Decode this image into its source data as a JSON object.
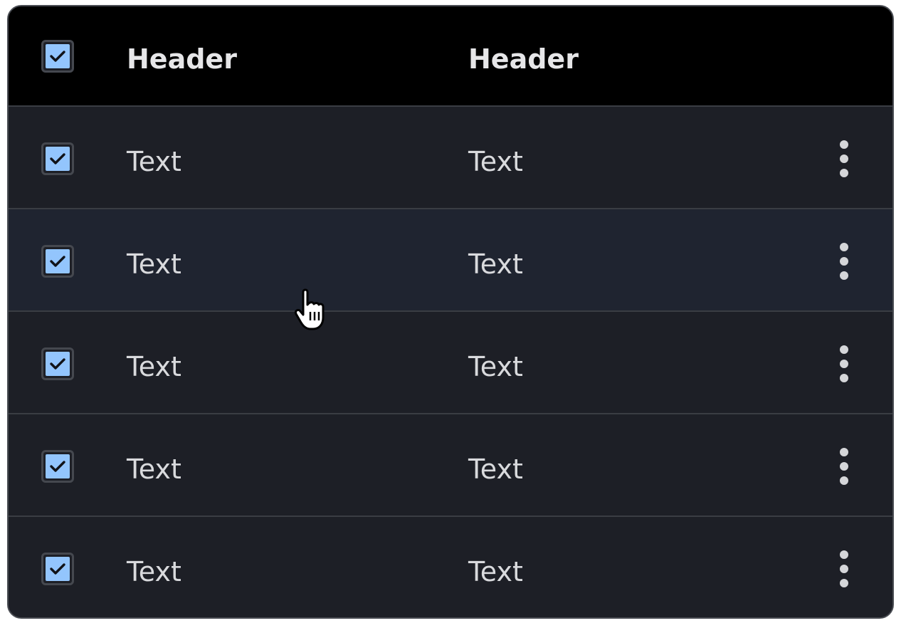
{
  "table": {
    "columns": [
      "Header",
      "Header"
    ],
    "header_checked": true,
    "rows": [
      {
        "cells": [
          "Text",
          "Text"
        ],
        "checked": true
      },
      {
        "cells": [
          "Text",
          "Text"
        ],
        "checked": true
      },
      {
        "cells": [
          "Text",
          "Text"
        ],
        "checked": true
      },
      {
        "cells": [
          "Text",
          "Text"
        ],
        "checked": true
      },
      {
        "cells": [
          "Text",
          "Text"
        ],
        "checked": true
      }
    ],
    "hovered_row_index": 1
  },
  "icons": {
    "checkbox": "checkmark-icon",
    "row_menu": "kebab-menu-icon",
    "cursor": "hand-pointer-cursor-icon"
  },
  "colors": {
    "checkbox_fill": "#93c5fd",
    "header_background": "#000000",
    "row_background": "#1d1f26",
    "hovered_row_background": "#1f2430"
  }
}
